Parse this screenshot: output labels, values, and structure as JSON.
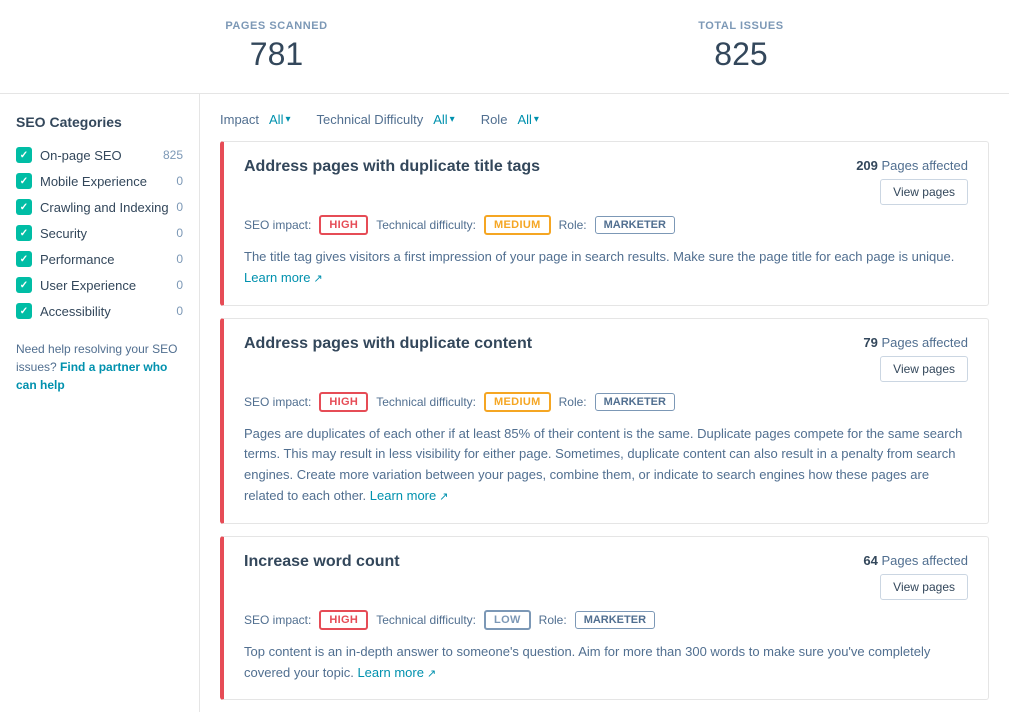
{
  "stats": {
    "pages_scanned_label": "PAGES SCANNED",
    "pages_scanned_value": "781",
    "total_issues_label": "TOTAL ISSUES",
    "total_issues_value": "825"
  },
  "sidebar": {
    "title": "SEO Categories",
    "items": [
      {
        "id": "on-page-seo",
        "label": "On-page SEO",
        "count": "825",
        "checked": true
      },
      {
        "id": "mobile-experience",
        "label": "Mobile Experience",
        "count": "0",
        "checked": true
      },
      {
        "id": "crawling-indexing",
        "label": "Crawling and Indexing",
        "count": "0",
        "checked": true
      },
      {
        "id": "security",
        "label": "Security",
        "count": "0",
        "checked": true
      },
      {
        "id": "performance",
        "label": "Performance",
        "count": "0",
        "checked": true
      },
      {
        "id": "user-experience",
        "label": "User Experience",
        "count": "0",
        "checked": true
      },
      {
        "id": "accessibility",
        "label": "Accessibility",
        "count": "0",
        "checked": true
      }
    ],
    "help_text": "Need help resolving your SEO issues?",
    "help_link_text": "Find a partner who can help",
    "help_link_url": "#"
  },
  "filters": {
    "impact_label": "Impact",
    "impact_value": "All",
    "technical_difficulty_label": "Technical Difficulty",
    "technical_difficulty_value": "All",
    "role_label": "Role",
    "role_value": "All"
  },
  "issues": [
    {
      "id": "duplicate-title-tags",
      "title": "Address pages with duplicate title tags",
      "pages_affected_count": "209",
      "pages_affected_label": "Pages affected",
      "view_pages_label": "View pages",
      "seo_impact_label": "SEO impact:",
      "impact_level": "HIGH",
      "impact_class": "impact-high",
      "tech_difficulty_label": "Technical difficulty:",
      "tech_difficulty": "MEDIUM",
      "tech_difficulty_class": "impact-medium",
      "role_label": "Role:",
      "role": "MARKETER",
      "description": "The title tag gives visitors a first impression of your page in search results. Make sure the page title for each page is unique.",
      "learn_more_label": "Learn more"
    },
    {
      "id": "duplicate-content",
      "title": "Address pages with duplicate content",
      "pages_affected_count": "79",
      "pages_affected_label": "Pages affected",
      "view_pages_label": "View pages",
      "seo_impact_label": "SEO impact:",
      "impact_level": "HIGH",
      "impact_class": "impact-high",
      "tech_difficulty_label": "Technical difficulty:",
      "tech_difficulty": "MEDIUM",
      "tech_difficulty_class": "impact-medium",
      "role_label": "Role:",
      "role": "MARKETER",
      "description": "Pages are duplicates of each other if at least 85% of their content is the same. Duplicate pages compete for the same search terms. This may result in less visibility for either page. Sometimes, duplicate content can also result in a penalty from search engines. Create more variation between your pages, combine them, or indicate to search engines how these pages are related to each other.",
      "learn_more_label": "Learn more"
    },
    {
      "id": "word-count",
      "title": "Increase word count",
      "pages_affected_count": "64",
      "pages_affected_label": "Pages affected",
      "view_pages_label": "View pages",
      "seo_impact_label": "SEO impact:",
      "impact_level": "HIGH",
      "impact_class": "impact-high",
      "tech_difficulty_label": "Technical difficulty:",
      "tech_difficulty": "LOW",
      "tech_difficulty_class": "impact-low",
      "role_label": "Role:",
      "role": "MARKETER",
      "description": "Top content is an in-depth answer to someone's question. Aim for more than 300 words to make sure you've completely covered your topic.",
      "learn_more_label": "Learn more"
    }
  ]
}
